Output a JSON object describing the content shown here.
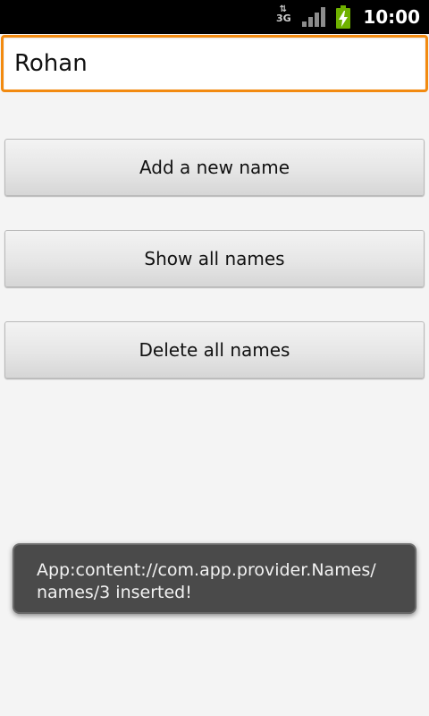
{
  "status_bar": {
    "network_label": "3G",
    "network_arrows": "⇅",
    "time": "10:00",
    "icons": [
      "network-3g-icon",
      "signal-icon",
      "battery-charging-icon"
    ],
    "battery_color": "#6fb100"
  },
  "name_field": {
    "value": "Rohan"
  },
  "buttons": {
    "add": "Add a new name",
    "show": "Show all names",
    "delete": "Delete all names"
  },
  "toast": {
    "line1": "App:content://com.app.provider.Names/",
    "line2": "names/3 inserted!"
  },
  "colors": {
    "focus_border": "#f28a10",
    "background": "#f4f4f4",
    "toast_background": "#4a4a4a"
  }
}
